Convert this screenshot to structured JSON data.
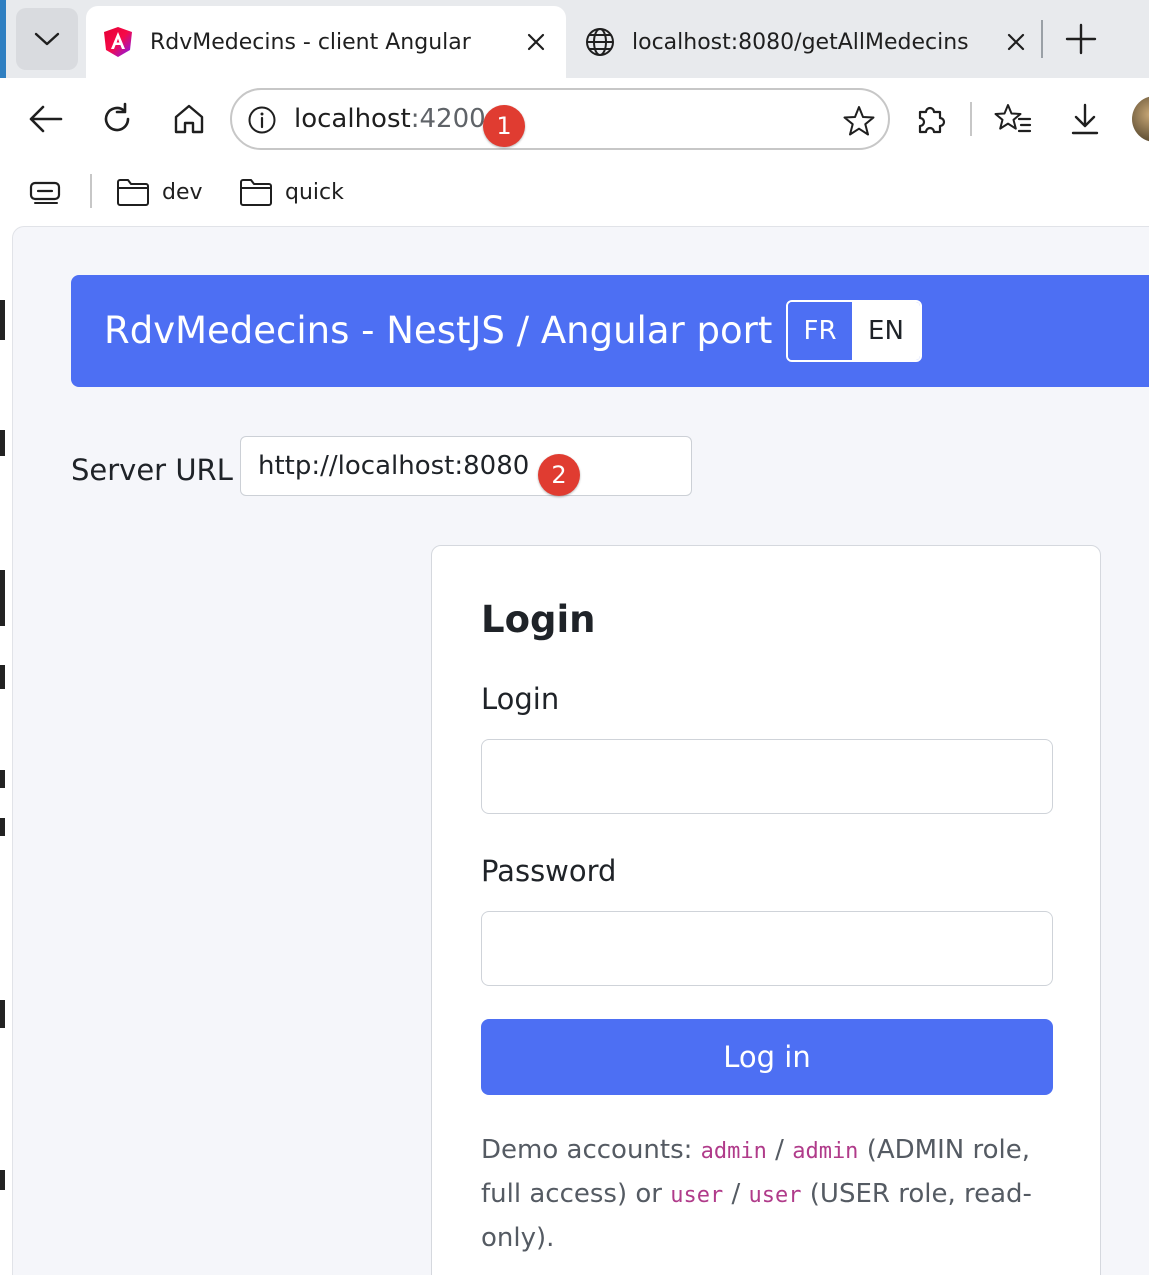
{
  "browser": {
    "tabs": [
      {
        "title": "RdvMedecins - client Angular",
        "icon": "angular-icon",
        "active": true
      },
      {
        "title": "localhost:8080/getAllMedecins",
        "icon": "globe-icon",
        "active": false
      }
    ],
    "address": {
      "host": "localhost",
      "port": ":4200"
    },
    "bookmarks": [
      {
        "label": "dev",
        "icon": "folder-icon"
      },
      {
        "label": "quick",
        "icon": "folder-icon"
      }
    ]
  },
  "annotations": {
    "badge1": "1",
    "badge2": "2"
  },
  "app": {
    "title": "RdvMedecins - NestJS / Angular port",
    "lang": {
      "fr": "FR",
      "en": "EN",
      "selected": "EN"
    },
    "server": {
      "label": "Server URL",
      "value": "http://localhost:8080"
    },
    "login_card": {
      "title": "Login",
      "login_label": "Login",
      "login_value": "",
      "password_label": "Password",
      "password_value": "",
      "submit": "Log in",
      "demo": {
        "prefix": "Demo accounts: ",
        "admin_user": "admin",
        "sep1": " / ",
        "admin_pass": "admin",
        "admin_desc": " (ADMIN role, full access) or ",
        "user_user": "user",
        "sep2": " / ",
        "user_pass": "user",
        "user_desc": " (USER role, read-only)."
      }
    }
  },
  "colors": {
    "accent": "#4d6ff3",
    "badge": "#e03c31",
    "code": "#b03b8a",
    "page_bg": "#f5f6fa"
  }
}
